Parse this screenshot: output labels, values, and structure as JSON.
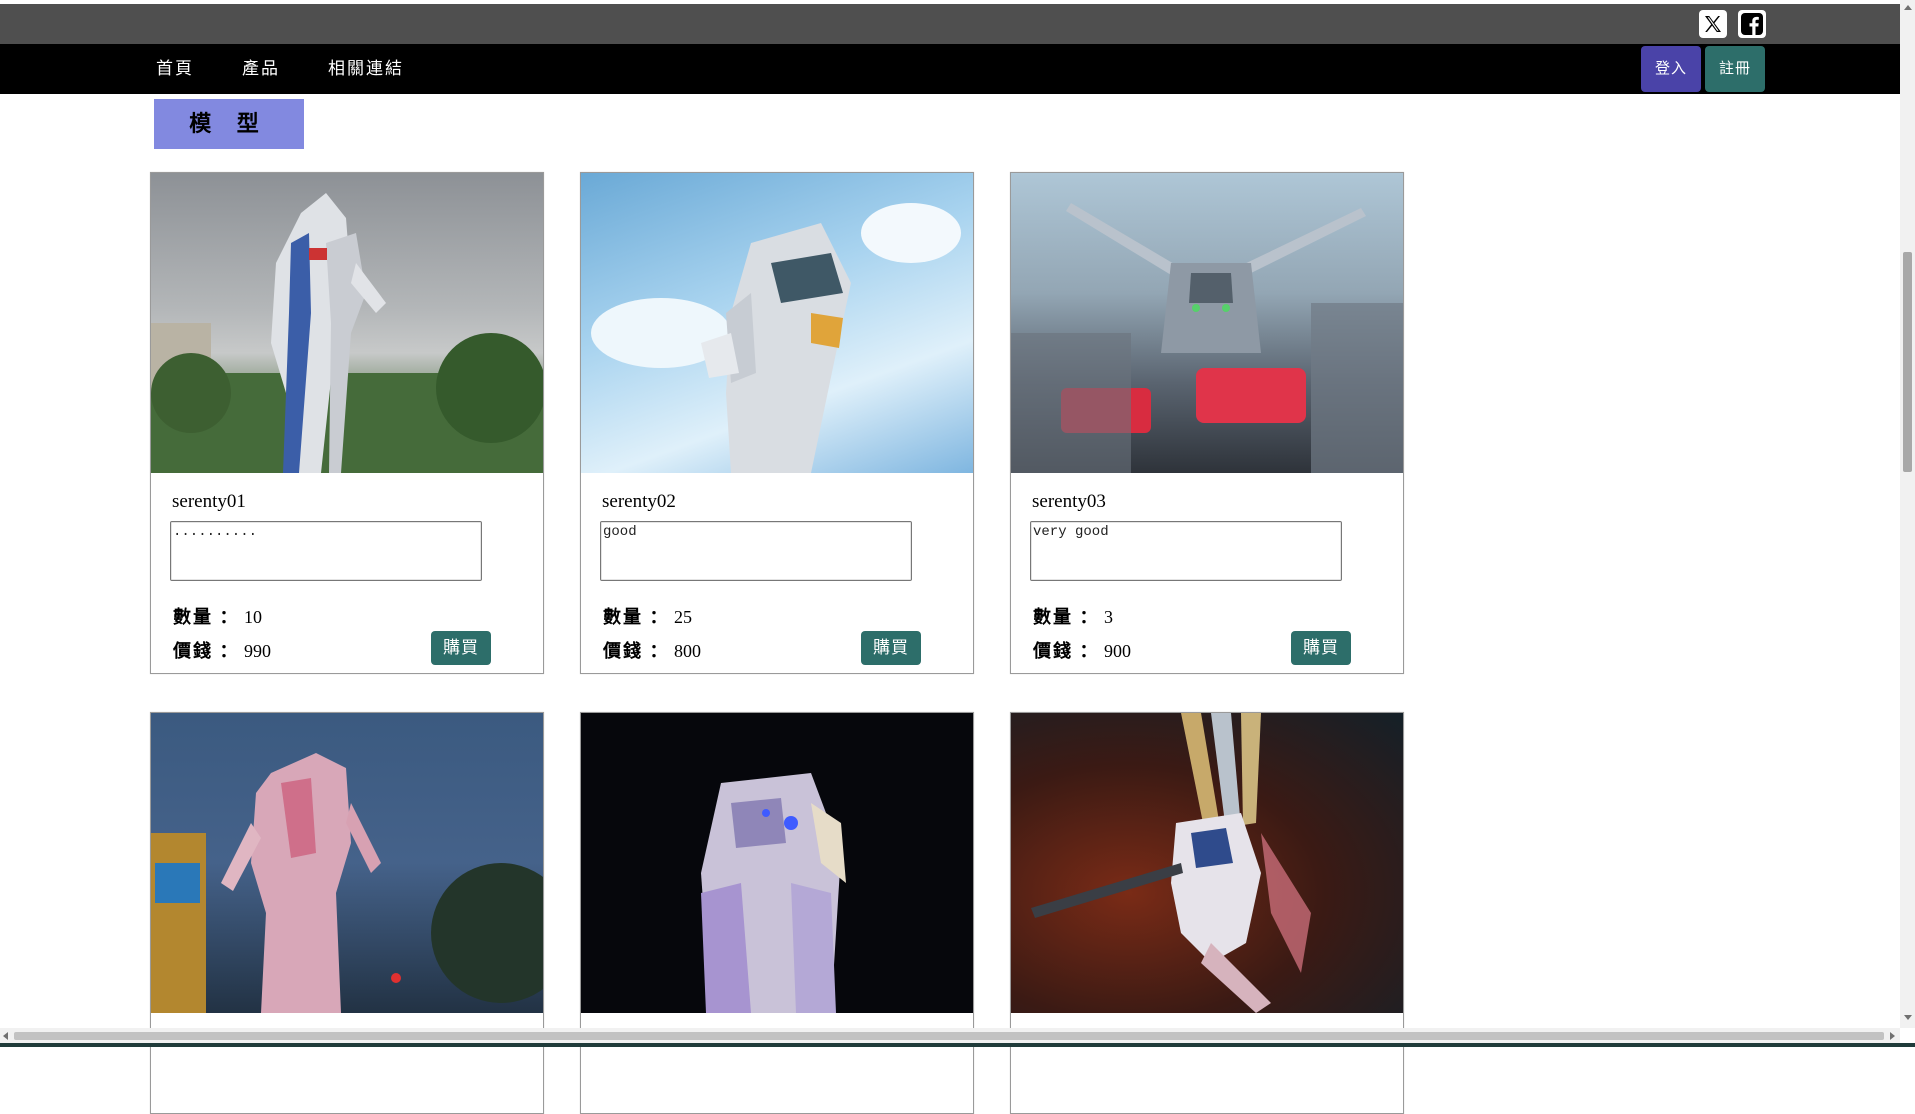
{
  "social": {
    "icons": [
      "x-icon",
      "facebook-icon"
    ]
  },
  "nav": {
    "home": "首頁",
    "products": "產品",
    "links": "相關連結",
    "login": "登入",
    "register": "註冊"
  },
  "section": {
    "title": "模 型"
  },
  "labels": {
    "quantity": "數量 ：",
    "price": "價錢 ：",
    "buy": "購買"
  },
  "products": [
    {
      "name": "serenty01",
      "comment": "..........",
      "quantity": "10",
      "price": "990"
    },
    {
      "name": "serenty02",
      "comment": "good",
      "quantity": "25",
      "price": "800"
    },
    {
      "name": "serenty03",
      "comment": "very good",
      "quantity": "3",
      "price": "900"
    }
  ],
  "colors": {
    "top_bar": "#4f4f4f",
    "nav_bar": "#000000",
    "login_button": "#4a43a8",
    "register_button": "#2d6e6a",
    "buy_button": "#2d6e6a",
    "section_title_bg": "#8289e0"
  }
}
